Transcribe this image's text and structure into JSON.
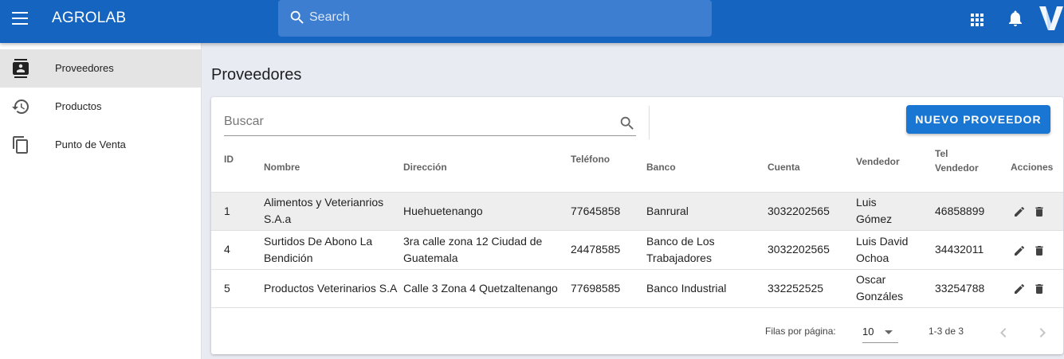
{
  "app": {
    "title": "AGROLAB",
    "brand_color": "#1565c0"
  },
  "search": {
    "placeholder": "Search"
  },
  "header_icons": [
    "menu-icon",
    "search-icon",
    "apps-grid-icon",
    "bell-icon",
    "v-logo"
  ],
  "sidebar": {
    "items": [
      {
        "label": "Proveedores",
        "icon": "contact-card-icon",
        "active": true
      },
      {
        "label": "Productos",
        "icon": "history-icon",
        "active": false
      },
      {
        "label": "Punto de Venta",
        "icon": "copy-icon",
        "active": false
      }
    ]
  },
  "main": {
    "title": "Proveedores",
    "search_placeholder": "Buscar",
    "new_button": "NUEVO PROVEEDOR",
    "accent": "#1976d2"
  },
  "table": {
    "headers": {
      "id": "ID",
      "nombre": "Nombre",
      "direccion": "Dirección",
      "telefono": "Teléfono",
      "banco": "Banco",
      "cuenta": "Cuenta",
      "vendedor": "Vendedor",
      "tel_vendedor_1": "Tel",
      "tel_vendedor_2": "Vendedor",
      "acciones": "Acciones"
    },
    "rows": [
      {
        "id": "1",
        "nombre": "Alimentos y Veterianrios S.A.a",
        "direccion": "Huehuetenango",
        "telefono": "77645858",
        "banco": "Banrural",
        "cuenta": "3032202565",
        "vendedor": "Luis Gómez",
        "tel_vendedor": "46858899"
      },
      {
        "id": "4",
        "nombre": "Surtidos De Abono La Bendición",
        "direccion": "3ra calle zona 12 Ciudad de Guatemala",
        "telefono": "24478585",
        "banco": "Banco de Los Trabajadores",
        "cuenta": "3032202565",
        "vendedor": "Luis David Ochoa",
        "tel_vendedor": "34432011"
      },
      {
        "id": "5",
        "nombre": "Productos Veterinarios S.A",
        "direccion": "Calle 3 Zona 4 Quetzaltenango",
        "telefono": "77698585",
        "banco": "Banco Industrial",
        "cuenta": "332252525",
        "vendedor": "Oscar Gonzáles",
        "tel_vendedor": "33254788"
      }
    ]
  },
  "pagination": {
    "rows_per_page_label": "Filas por página:",
    "rows_per_page": "10",
    "range": "1-3 de 3"
  }
}
